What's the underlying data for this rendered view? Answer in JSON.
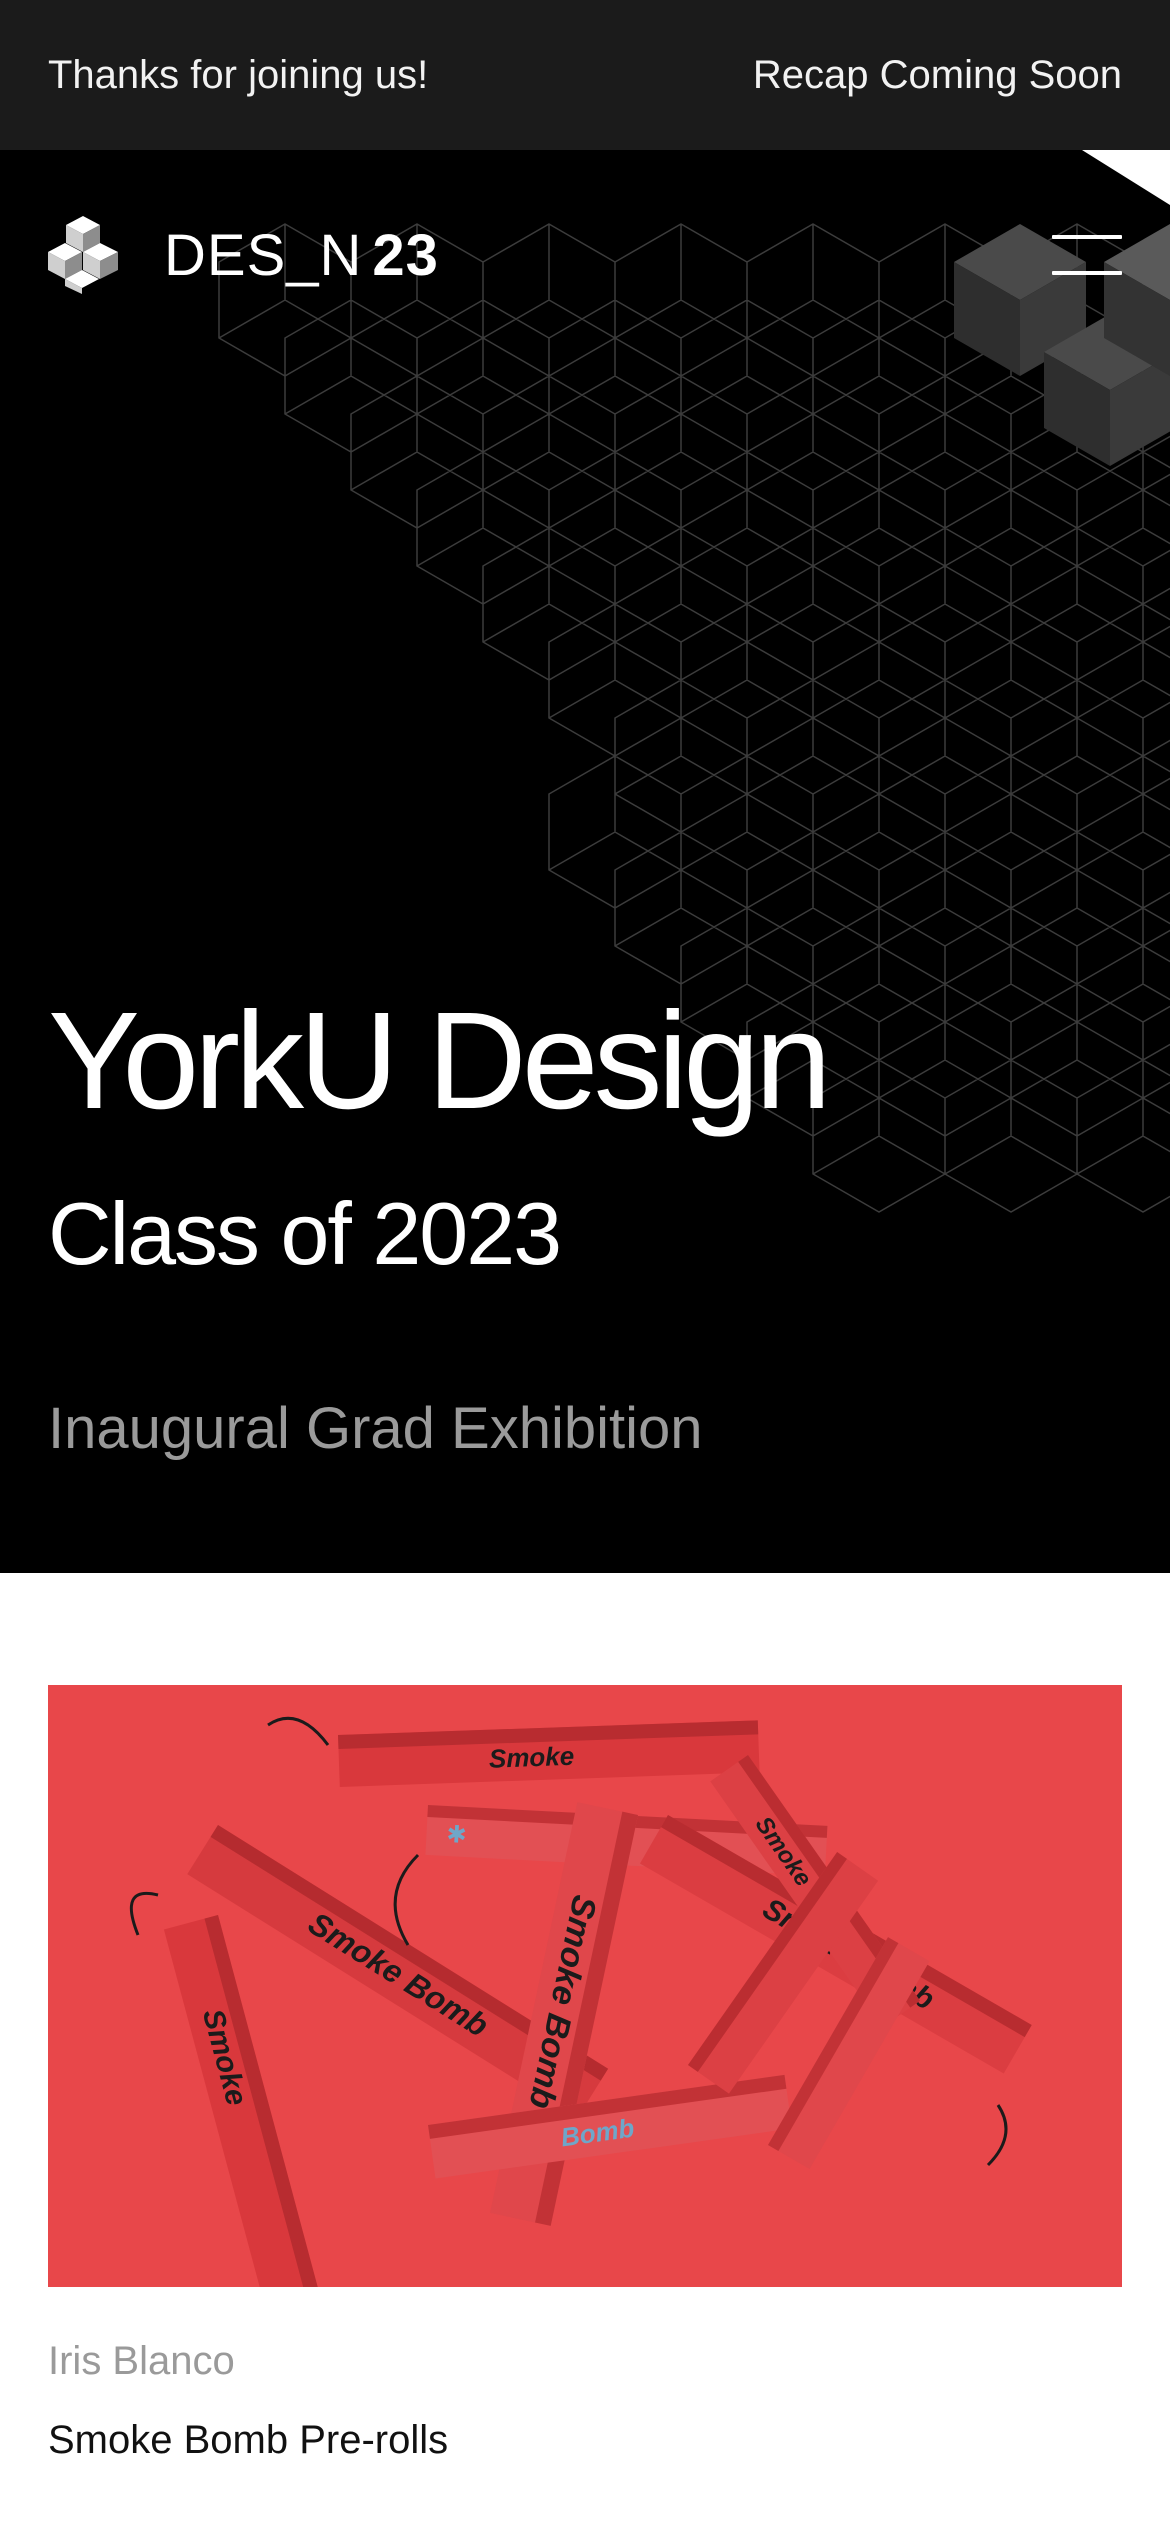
{
  "announcement": {
    "left_text": "Thanks for joining us!",
    "right_link": "Recap Coming Soon"
  },
  "brand": {
    "name_prefix": "DES_N",
    "name_year": "23"
  },
  "nav": {
    "menu_icon": "hamburger-menu-icon"
  },
  "hero": {
    "title": "YorkU Design",
    "subtitle": "Class of 2023",
    "tagline": "Inaugural Grad Exhibition"
  },
  "featured_project": {
    "author": "Iris Blanco",
    "title": "Smoke Bomb Pre-rolls",
    "image_colors": {
      "background": "#e8474a",
      "box": "#d9383c",
      "print": "#1b1b1b",
      "accent": "#6fa6c9"
    }
  },
  "colors": {
    "announcement_bg": "#1b1b1b",
    "hero_bg": "#000000",
    "muted_text": "#9a9a9a"
  }
}
